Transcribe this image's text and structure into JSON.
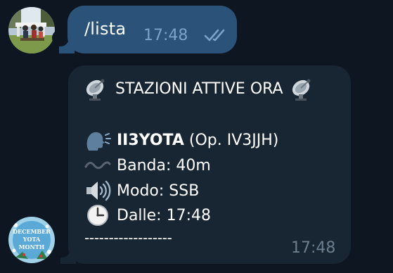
{
  "outgoing": {
    "text": "/lista",
    "time": "17:48",
    "status_icon": "double-check-icon"
  },
  "incoming": {
    "title": "STAZIONI ATTIVE ORA",
    "station_call": "II3YOTA",
    "station_operator": "(Op. IV3JJH)",
    "band": "Banda: 40m",
    "mode": "Modo: SSB",
    "since": "Dalle: 17:48",
    "separator": "------------------",
    "time": "17:48"
  },
  "avatars": {
    "user": "user-avatar",
    "bot": "bot-avatar"
  },
  "bot_avatar_text": [
    "DECEMBER",
    "YOTA",
    "MONTH"
  ],
  "colors": {
    "background": "#0e1621",
    "outgoing_bubble": "#2b5278",
    "incoming_bubble": "#182533",
    "outgoing_time": "#7aa3c7",
    "incoming_time": "#6d7f8f",
    "text": "#ffffff"
  }
}
